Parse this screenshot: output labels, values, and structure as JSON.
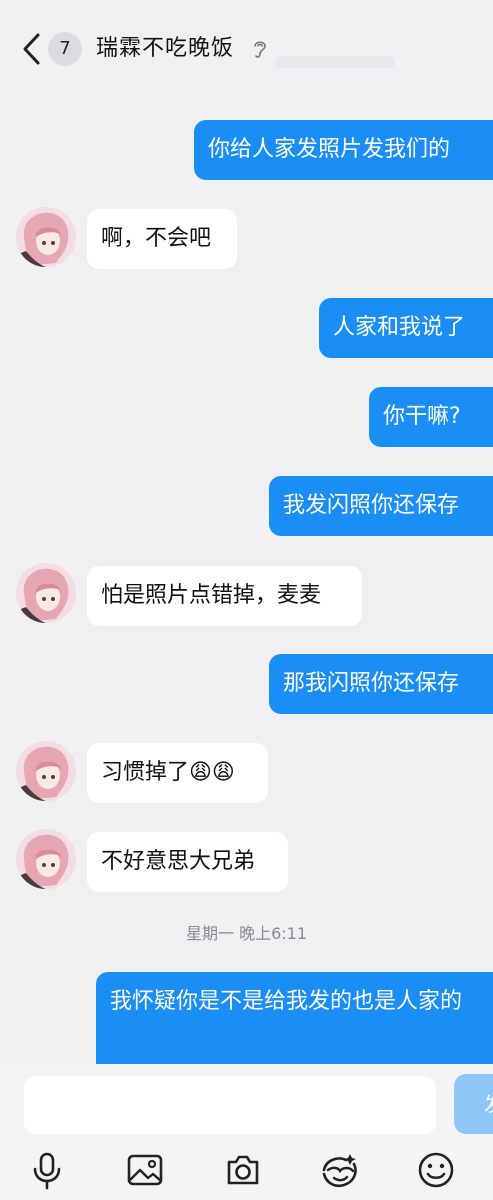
{
  "header": {
    "back_icon": "chevron-left-icon",
    "unread_count": "7",
    "title": "瑞霖不吃晚饭",
    "ear_icon": "hearing-icon"
  },
  "messages": [
    {
      "side": "out",
      "text": "你给人家发照片发我们的"
    },
    {
      "side": "in",
      "text": "啊，不会吧"
    },
    {
      "side": "out",
      "text": "人家和我说了"
    },
    {
      "side": "out",
      "text": "你干嘛?"
    },
    {
      "side": "out",
      "text": "我发闪照你还保存"
    },
    {
      "side": "in",
      "text": "怕是照片点错掉，麦麦"
    },
    {
      "side": "out",
      "text": "那我闪照你还保存"
    },
    {
      "side": "in",
      "text": "习惯掉了😩😩"
    },
    {
      "side": "in",
      "text": "不好意思大兄弟"
    },
    {
      "side": "out",
      "text": "我怀疑你是不是给我发的也是人家的"
    }
  ],
  "timestamp": "星期一 晚上6:11",
  "input": {
    "placeholder": "",
    "send_label": "发"
  },
  "toolbar": {
    "icons": [
      "microphone-icon",
      "image-icon",
      "camera-icon",
      "sticker-icon",
      "emoji-icon"
    ]
  },
  "colors": {
    "outgoing_bubble": "#1b8ef6",
    "incoming_bubble": "#ffffff",
    "background": "#f0f0f2"
  }
}
